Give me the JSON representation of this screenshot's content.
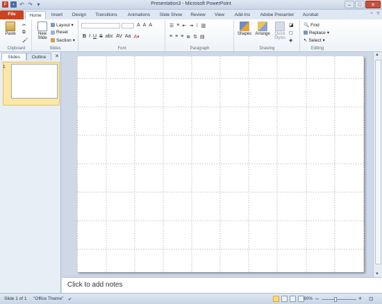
{
  "window": {
    "title": "Presentation3 - Microsoft PowerPoint",
    "controls": {
      "minimize": "–",
      "maximize": "□",
      "close": "✕"
    }
  },
  "quick_access": {
    "icons": [
      "powerpoint-app-icon",
      "save-icon",
      "undo-icon",
      "redo-icon",
      "customize-icon"
    ]
  },
  "tabs": [
    "File",
    "Home",
    "Insert",
    "Design",
    "Transitions",
    "Animations",
    "Slide Show",
    "Review",
    "View",
    "Add-Ins",
    "Adobe Presenter",
    "Acrobat"
  ],
  "active_tab": "Home",
  "ribbon": {
    "clipboard": {
      "label": "Clipboard",
      "paste": "Paste"
    },
    "slides": {
      "label": "Slides",
      "new_slide_line1": "New",
      "new_slide_line2": "Slide",
      "layout": "Layout",
      "reset": "Reset",
      "section": "Section"
    },
    "font": {
      "label": "Font",
      "bold": "B",
      "italic": "I",
      "underline": "U",
      "strike": "S",
      "shadow": "abc",
      "spacing": "AV",
      "case": "Aa",
      "grow": "A",
      "shrink": "A",
      "clear": "A"
    },
    "paragraph": {
      "label": "Paragraph"
    },
    "drawing": {
      "label": "Drawing",
      "shapes": "Shapes",
      "arrange": "Arrange",
      "quick_styles_line1": "Quick",
      "quick_styles_line2": "Styles"
    },
    "editing": {
      "label": "Editing",
      "find": "Find",
      "replace": "Replace",
      "select": "Select"
    }
  },
  "left_pane": {
    "tab_slides": "Slides",
    "tab_outline": "Outline",
    "close": "✕",
    "slide_number": "1"
  },
  "notes": {
    "placeholder": "Click to add notes"
  },
  "status": {
    "slide_info": "Slide 1 of 1",
    "theme": "\"Office Theme\"",
    "zoom": "80%",
    "zoom_out": "–",
    "zoom_in": "+"
  },
  "colors": {
    "file_tab": "#c9441f",
    "ribbon_bg": "#eef2f8",
    "workspace": "#cfd8e6",
    "thumbnail_highlight": "#fbe7a6"
  }
}
